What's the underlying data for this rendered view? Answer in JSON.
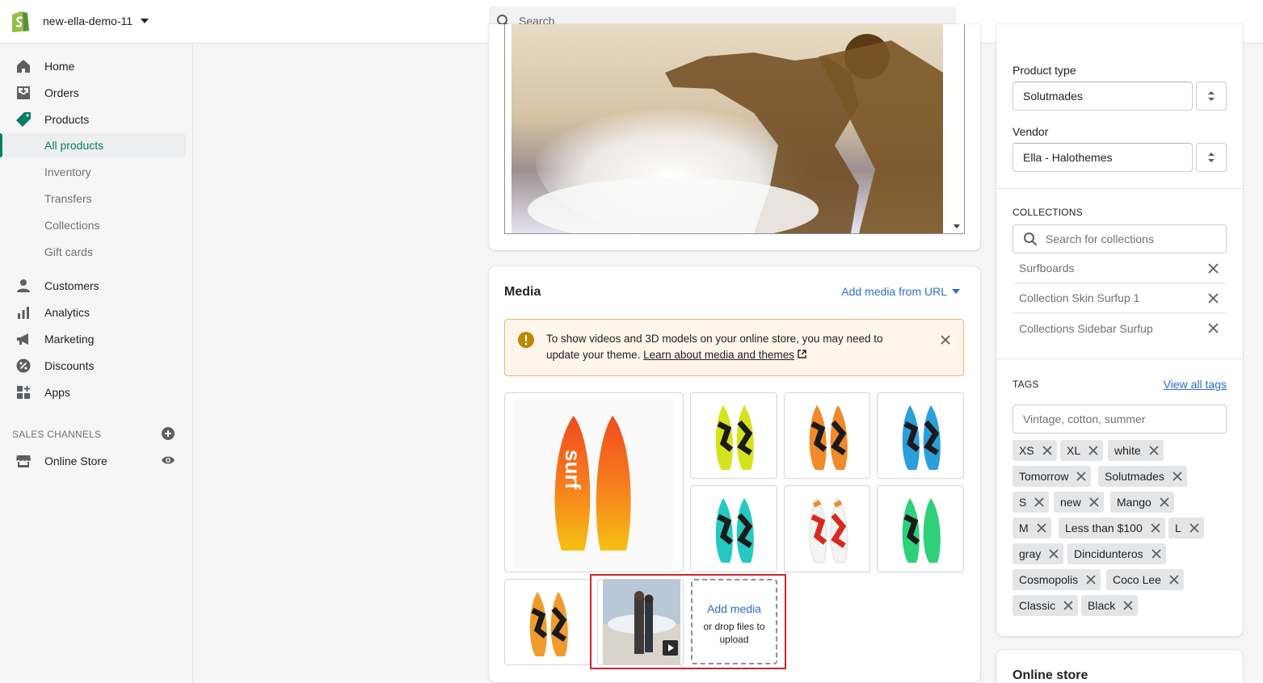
{
  "topbar": {
    "store_name": "new-ella-demo-11",
    "search_placeholder": "Search"
  },
  "sidebar": {
    "items": [
      {
        "label": "Home"
      },
      {
        "label": "Orders"
      },
      {
        "label": "Products"
      },
      {
        "label": "Customers"
      },
      {
        "label": "Analytics"
      },
      {
        "label": "Marketing"
      },
      {
        "label": "Discounts"
      },
      {
        "label": "Apps"
      }
    ],
    "product_subitems": [
      {
        "label": "All products",
        "active": true
      },
      {
        "label": "Inventory"
      },
      {
        "label": "Transfers"
      },
      {
        "label": "Collections"
      },
      {
        "label": "Gift cards"
      }
    ],
    "sales_channels_title": "SALES CHANNELS",
    "online_store": "Online Store"
  },
  "media": {
    "title": "Media",
    "add_from_url": "Add media from URL",
    "banner_text": "To show videos and 3D models on your online store, you may need to update your theme.",
    "banner_link": "Learn about media and themes",
    "add_media_label": "Add media",
    "drop_label": "or drop files to upload"
  },
  "organization": {
    "product_type_label": "Product type",
    "product_type_value": "Solutmades",
    "vendor_label": "Vendor",
    "vendor_value": "Ella - Halothemes",
    "collections_title": "COLLECTIONS",
    "collections_search_placeholder": "Search for collections",
    "collections": [
      "Surfboards",
      "Collection Skin Surfup 1",
      "Collections Sidebar Surfup"
    ],
    "tags_title": "TAGS",
    "view_all_tags": "View all tags",
    "tags_placeholder": "Vintage, cotton, summer",
    "tags": [
      "XS",
      "XL",
      "white",
      "Tomorrow",
      "Solutmades",
      "S",
      "new",
      "Mango",
      "M",
      "Less than $100",
      "L",
      "gray",
      "Dincidunteros",
      "Cosmopolis",
      "Coco Lee",
      "Classic",
      "Black"
    ]
  },
  "online_store_card": {
    "title": "Online store"
  },
  "colors": {
    "accent_green": "#008060",
    "link_blue": "#2c6ecb",
    "warning_bg": "#fff5ea",
    "highlight_red": "#d0242b"
  }
}
